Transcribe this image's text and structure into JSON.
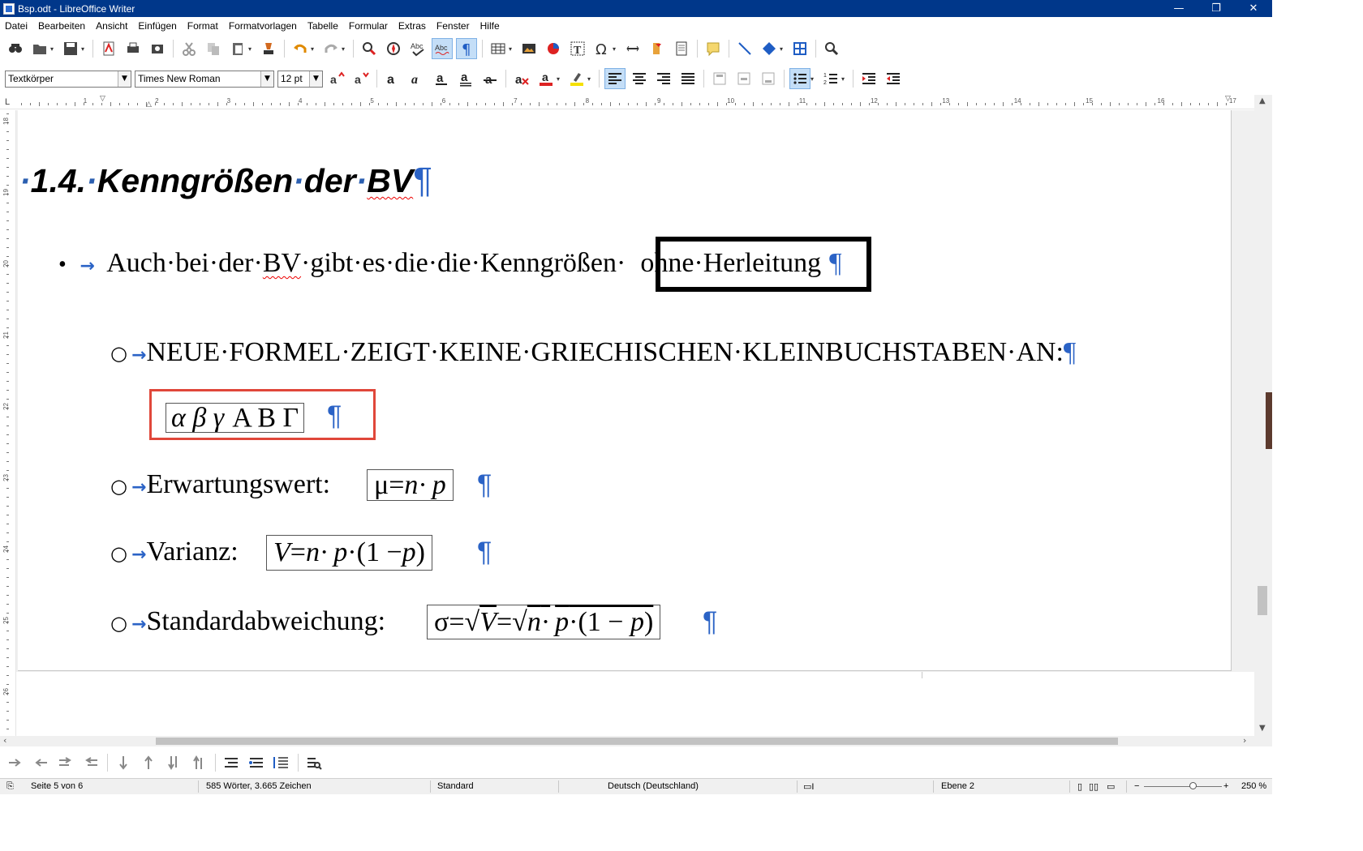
{
  "window": {
    "title": "Bsp.odt - LibreOffice Writer",
    "buttons": {
      "minimize": "—",
      "restore": "❐",
      "close": "✕"
    }
  },
  "menu": [
    "Datei",
    "Bearbeiten",
    "Ansicht",
    "Einfügen",
    "Format",
    "Formatvorlagen",
    "Tabelle",
    "Formular",
    "Extras",
    "Fenster",
    "Hilfe"
  ],
  "formatting": {
    "paragraph_style": "Textkörper",
    "font_name": "Times New Roman",
    "font_size": "12 pt"
  },
  "ruler": {
    "h_numbers": [
      "1",
      "2",
      "3",
      "4",
      "5",
      "6",
      "7",
      "8",
      "9",
      "10",
      "11",
      "12",
      "13",
      "14",
      "15",
      "16",
      "17"
    ],
    "v_numbers": [
      "18",
      "19",
      "20",
      "21",
      "22",
      "23",
      "24",
      "25",
      "26"
    ]
  },
  "document": {
    "heading": {
      "lead_dot": "·",
      "number": "1.4.",
      "dot1": "·",
      "word1": "Kenngrößen",
      "dot2": "·",
      "word2": "der",
      "dot3": "·",
      "word3": "BV",
      "pilcrow": "¶"
    },
    "bullet1": {
      "bullet": "•",
      "arrow": "→",
      "text_a": "Auch·bei·der·",
      "text_bv": "BV",
      "text_b": "·gibt·es·die·die·Kenngrößen·",
      "boxed": "ohne·Herleitung",
      "pilcrow": "¶"
    },
    "sub_items": [
      {
        "bullet": "○",
        "arrow": "→",
        "text": "NEUE·FORMEL·ZEIGT·KEINE·GRIECHISCHEN·KLEINBUCHSTABEN·AN:",
        "pilcrow": "¶"
      },
      {
        "bullet": "○",
        "arrow": "→",
        "text": "Erwartungswert:",
        "pilcrow": "¶"
      },
      {
        "bullet": "○",
        "arrow": "→",
        "text": "Varianz:",
        "pilcrow": "¶"
      },
      {
        "bullet": "○",
        "arrow": "→",
        "text": "Standardabweichung:",
        "pilcrow": "¶"
      }
    ],
    "greek_formula": {
      "lower": "α β γ",
      "upper": "Α Β Γ",
      "pilcrow": "¶"
    },
    "formulas": {
      "erwartungswert": {
        "mu": "μ",
        "eq": "=",
        "n": "n",
        "dot": "·",
        "p": "p"
      },
      "varianz": {
        "V": "V",
        "eq": "=",
        "n": "n",
        "dot1": "·",
        "p": "p",
        "dot2": "·",
        "paren": "(1 − ",
        "p2": "p",
        "close": ")"
      },
      "std": {
        "sigma": "σ",
        "eq1": "=",
        "sqrt1": "√",
        "V": "V",
        "eq2": "=",
        "sqrt2": "√",
        "n": "n",
        "dot1": "·",
        "p": "p",
        "dot2": "·",
        "paren": "(1 − ",
        "p2": "p",
        "close": ")"
      }
    }
  },
  "status": {
    "page": "Seite 5 von 6",
    "words": "585 Wörter, 3.665 Zeichen",
    "style": "Standard",
    "language": "Deutsch (Deutschland)",
    "level": "Ebene 2",
    "zoom": "250 %",
    "zoom_minus": "−",
    "zoom_plus": "+"
  },
  "colors": {
    "titlebar": "#00378a",
    "formatting_marks": "#2b63c6",
    "highlight_box": "#e0473a"
  }
}
